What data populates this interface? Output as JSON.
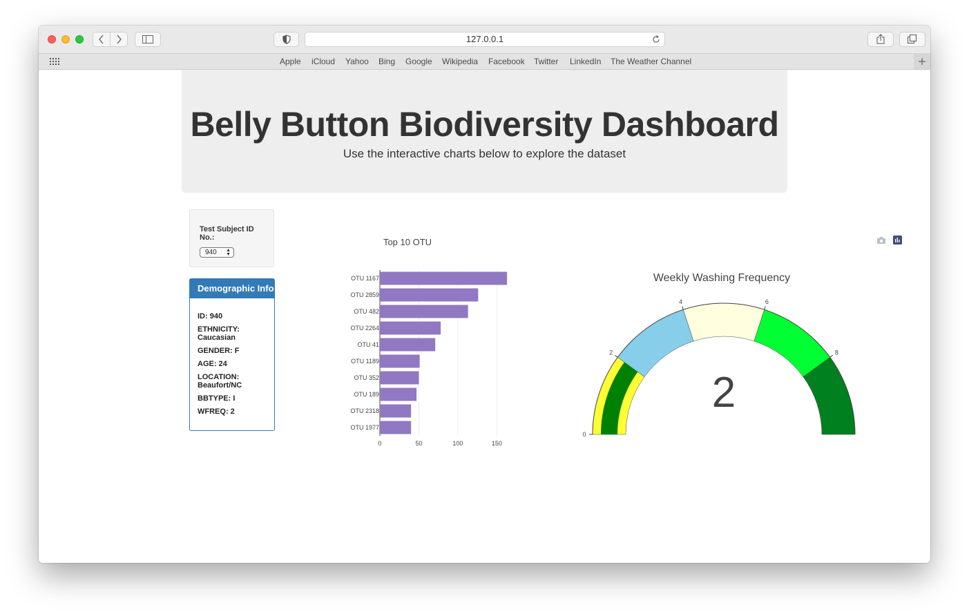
{
  "browser": {
    "url": "127.0.0.1",
    "bookmarks": [
      "Apple",
      "iCloud",
      "Yahoo",
      "Bing",
      "Google",
      "Wikipedia",
      "Facebook",
      "Twitter",
      "LinkedIn",
      "The Weather Channel"
    ]
  },
  "header": {
    "title": "Belly Button Biodiversity Dashboard",
    "subtitle": "Use the interactive charts below to explore the dataset"
  },
  "selector": {
    "label": "Test Subject ID No.:",
    "selected": "940"
  },
  "demographics": {
    "heading": "Demographic Info",
    "lines": [
      "ID: 940",
      "ETHNICITY: Caucasian",
      "GENDER: F",
      "AGE: 24",
      "LOCATION: Beaufort/NC",
      "BBTYPE: I",
      "WFREQ: 2"
    ]
  },
  "colors": {
    "bar": "#9079c2",
    "panel": "#337ab7",
    "gauge_steps": [
      "#ffff33",
      "#008000",
      "#87ceeb",
      "#ffffe0",
      "#00ff33",
      "#00801e"
    ]
  },
  "icons": [
    "camera-icon",
    "plotly-logo-icon"
  ],
  "chart_data": [
    {
      "type": "bar",
      "orientation": "horizontal",
      "title": "Top 10 OTU",
      "categories": [
        "OTU 1167",
        "OTU 2859",
        "OTU 482",
        "OTU 2264",
        "OTU 41",
        "OTU 1189",
        "OTU 352",
        "OTU 189",
        "OTU 2318",
        "OTU 1977"
      ],
      "values": [
        163,
        126,
        113,
        78,
        71,
        51,
        50,
        47,
        40,
        40
      ],
      "xticks": [
        0,
        50,
        100,
        150
      ],
      "xlim": [
        0,
        170
      ],
      "grid": true
    },
    {
      "type": "gauge",
      "title": "Weekly Washing Frequency",
      "value": 2,
      "range": [
        0,
        10
      ],
      "ticks": [
        0,
        2,
        4,
        6,
        8
      ],
      "steps": [
        [
          0,
          2
        ],
        [
          2,
          4
        ],
        [
          4,
          6
        ],
        [
          6,
          8
        ],
        [
          8,
          10
        ]
      ]
    }
  ]
}
